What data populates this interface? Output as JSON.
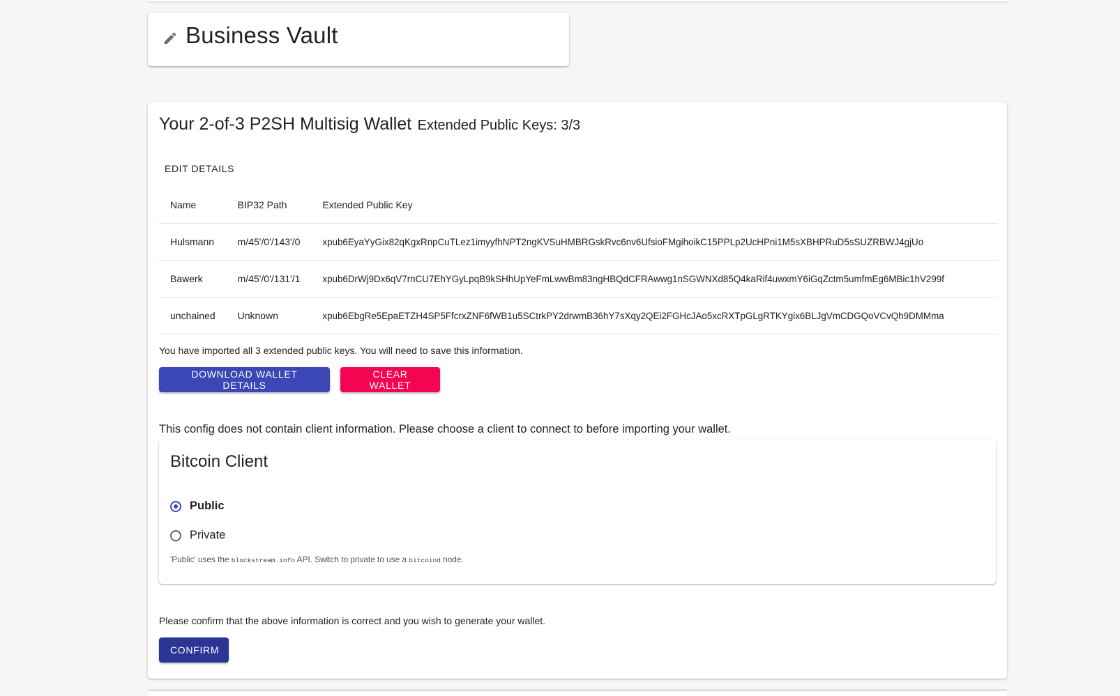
{
  "title_card": {
    "vault_name": "Business Vault",
    "icon": "pencil-icon"
  },
  "wallet": {
    "heading": "Your 2-of-3 P2SH Multisig Wallet",
    "subheading": "Extended Public Keys: 3/3",
    "edit_details_label": "EDIT DETAILS",
    "table": {
      "headers": [
        "Name",
        "BIP32 Path",
        "Extended Public Key"
      ],
      "rows": [
        {
          "name": "Hulsmann",
          "path": "m/45'/0'/143'/0",
          "xpub": "xpub6EyaYyGix82qKgxRnpCuTLez1imyyfhNPT2ngKVSuHMBRGskRvc6nv6UfsioFMgihoikC15PPLp2UcHPni1M5sXBHPRuD5sSUZRBWJ4gjUo"
        },
        {
          "name": "Bawerk",
          "path": "m/45'/0'/131'/1",
          "xpub": "xpub6DrWj9Dx6qV7rnCU7EhYGyLpqB9kSHhUpYeFmLwwBm83ngHBQdCFRAwwg1nSGWNXd85Q4kaRif4uwxmY6iGqZctm5umfmEg6MBic1hV299f"
        },
        {
          "name": "unchained",
          "path": "Unknown",
          "xpub": "xpub6EbgRe5EpaETZH4SP5FfcrxZNF6fWB1u5SCtrkPY2drwmB36hY7sXqy2QEi2FGHcJAo5xcRXTpGLgRTKYgix6BLJgVmCDGQoVCvQh9DMMma"
        }
      ]
    },
    "imported_note": "You have imported all 3 extended public keys. You will need to save this information.",
    "download_button": "DOWNLOAD WALLET DETAILS",
    "clear_button": "CLEAR WALLET",
    "config_note": "This config does not contain client information. Please choose a client to connect to before importing your wallet.",
    "client": {
      "title": "Bitcoin Client",
      "options": [
        {
          "label": "Public",
          "selected": true
        },
        {
          "label": "Private",
          "selected": false
        }
      ],
      "help": {
        "part1": "'Public' uses the ",
        "code1": "blockstream.info",
        "part2": " API. Switch to private to use a ",
        "code2": "bitcoind",
        "part3": " node."
      }
    },
    "confirm_note": "Please confirm that the above information is correct and you wish to generate your wallet.",
    "confirm_button": "CONFIRM"
  },
  "colors": {
    "primary": "#3a47b4",
    "secondary": "#f50551",
    "confirm": "#2b3595",
    "background": "#f6f6f6"
  }
}
